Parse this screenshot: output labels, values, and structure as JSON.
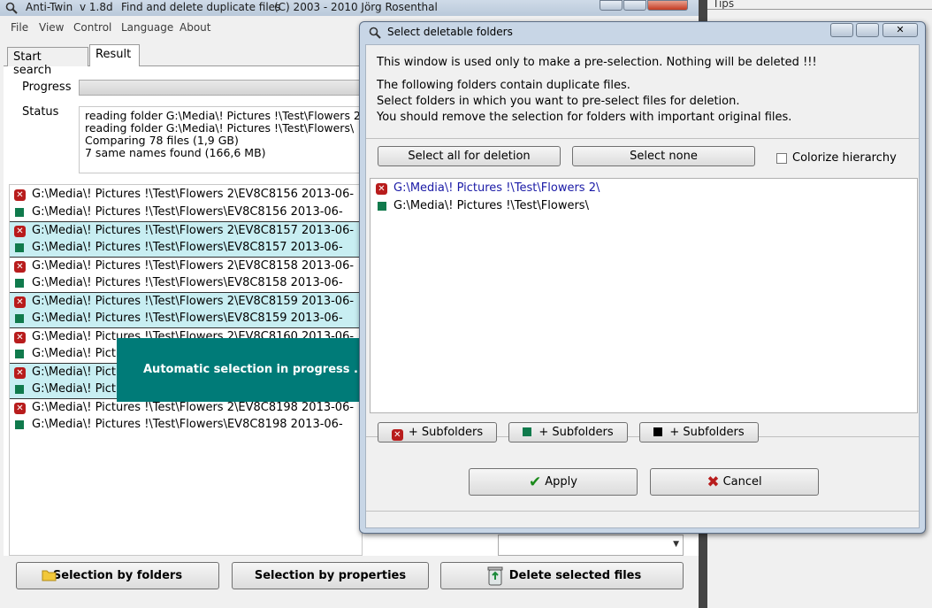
{
  "main_window": {
    "app_name": "Anti-Twin",
    "version": "v 1.8d",
    "tagline": "Find and delete duplicate files",
    "copyright": "(C) 2003 - 2010  Jörg Rosenthal",
    "menu": [
      "File",
      "View",
      "Control",
      "Language",
      "About"
    ],
    "tabs": [
      "Start search",
      "Result"
    ],
    "progress_label": "Progress",
    "status_label": "Status",
    "status_lines": [
      "reading folder G:\\Media\\! Pictures !\\Test\\Flowers 2\\",
      "reading folder G:\\Media\\! Pictures !\\Test\\Flowers\\",
      "Comparing 78 files (1,9 GB)",
      "7 same names found (166,6 MB)"
    ],
    "file_rows": [
      {
        "text": "G:\\Media\\! Pictures !\\Test\\Flowers 2\\EV8C8156 2013-06-",
        "marker": "delete",
        "selected": false
      },
      {
        "text": "G:\\Media\\! Pictures !\\Test\\Flowers\\EV8C8156 2013-06-",
        "marker": "keep",
        "selected": false
      },
      {
        "text": "G:\\Media\\! Pictures !\\Test\\Flowers 2\\EV8C8157 2013-06-",
        "marker": "delete",
        "selected": true
      },
      {
        "text": "G:\\Media\\! Pictures !\\Test\\Flowers\\EV8C8157 2013-06-",
        "marker": "keep",
        "selected": true
      },
      {
        "text": "G:\\Media\\! Pictures !\\Test\\Flowers 2\\EV8C8158 2013-06-",
        "marker": "delete",
        "selected": false
      },
      {
        "text": "G:\\Media\\! Pictures !\\Test\\Flowers\\EV8C8158 2013-06-",
        "marker": "keep",
        "selected": false
      },
      {
        "text": "G:\\Media\\! Pictures !\\Test\\Flowers 2\\EV8C8159 2013-06-",
        "marker": "delete",
        "selected": true
      },
      {
        "text": "G:\\Media\\! Pictures !\\Test\\Flowers\\EV8C8159 2013-06-",
        "marker": "keep",
        "selected": true
      },
      {
        "text": "G:\\Media\\! Pictures !\\Test\\Flowers 2\\EV8C8160 2013-06-",
        "marker": "delete",
        "selected": false
      },
      {
        "text": "G:\\Media\\! Pictures !\\Test\\Flowers\\EV8C8160 2013-06-",
        "marker": "keep",
        "selected": false
      },
      {
        "text": "G:\\Media\\! Pictures !\\Test\\Flowers 2\\EV8C8161 2013-06-",
        "marker": "delete",
        "selected": true
      },
      {
        "text": "G:\\Media\\! Pictures !\\Test\\Flowers\\EV8C8161 2013-06-",
        "marker": "keep",
        "selected": true
      },
      {
        "text": "G:\\Media\\! Pictures !\\Test\\Flowers 2\\EV8C8198 2013-06-",
        "marker": "delete",
        "selected": false
      },
      {
        "text": "G:\\Media\\! Pictures !\\Test\\Flowers\\EV8C8198 2013-06-",
        "marker": "keep",
        "selected": false
      }
    ],
    "overlay_text": "Automatic selection in progress ...",
    "buttons": {
      "selection_by_folders": "Selection by folders",
      "selection_by_properties": "Selection by properties",
      "delete_selected": "Delete selected files"
    }
  },
  "background_window": {
    "title": "Tips"
  },
  "dialog": {
    "title": "Select deletable folders",
    "notice": "This window is used only to make a pre-selection. Nothing will be deleted !!!",
    "instructions": [
      "The following folders contain duplicate files.",
      "Select folders in which you want to pre-select files for deletion.",
      "You should remove the selection for folders with important original files."
    ],
    "select_all_label": "Select all for deletion",
    "select_none_label": "Select none",
    "colorize_label": "Colorize hierarchy",
    "colorize_checked": false,
    "folders": [
      {
        "path": "G:\\Media\\! Pictures !\\Test\\Flowers 2\\",
        "marker": "delete"
      },
      {
        "path": "G:\\Media\\! Pictures !\\Test\\Flowers\\",
        "marker": "keep"
      }
    ],
    "subfolder_buttons": [
      "+ Subfolders",
      "+ Subfolders",
      "+ Subfolders"
    ],
    "apply_label": "Apply",
    "cancel_label": "Cancel"
  },
  "colors": {
    "delete_marker": "#b81c1c",
    "keep_marker": "#107a4c",
    "selected_row": "#c8eef2",
    "overlay": "#007b78",
    "link_text": "#1a1aa6"
  }
}
